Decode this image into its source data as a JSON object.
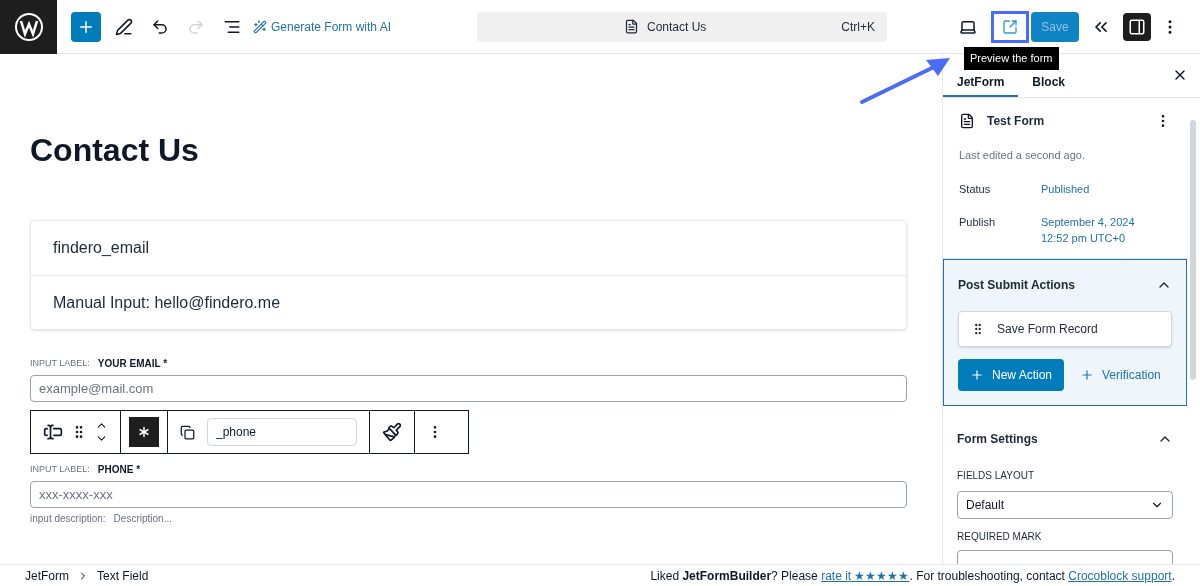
{
  "top_bar": {
    "generate_ai": "Generate Form with AI",
    "document_title": "Contact Us",
    "shortcut": "Ctrl+K",
    "undo_disabled": false,
    "redo_disabled": true,
    "preview_highlighted": true,
    "tooltip": "Preview the form",
    "save": "Save",
    "save_disabled": true,
    "sidebar_open": true
  },
  "canvas": {
    "title": "Contact Us",
    "info_rows": [
      "findero_email",
      "Manual Input: hello@findero.me"
    ],
    "fields": [
      {
        "label_prefix": "INPUT LABEL:",
        "label": "YOUR EMAIL *",
        "placeholder": "example@mail.com"
      },
      {
        "label_prefix": "INPUT LABEL:",
        "label": "PHONE *",
        "placeholder": "xxx-xxxx-xxx",
        "description_prefix": "input description:",
        "description": "Description..."
      }
    ],
    "block_toolbar": {
      "field_name": "_phone",
      "required_on": true
    }
  },
  "breadcrumb": [
    "JetForm",
    "Text Field"
  ],
  "sidebar": {
    "tabs": [
      {
        "label": "JetForm",
        "selected": true
      },
      {
        "label": "Block",
        "selected": false
      }
    ],
    "form": {
      "title": "Test Form",
      "last_edited": "Last edited a second ago.",
      "rows": [
        {
          "label": "Status",
          "value": "Published"
        },
        {
          "label": "Publish",
          "value": "September 4, 2024 12:52 pm UTC+0"
        }
      ]
    },
    "actions_panel": {
      "title": "Post Submit Actions",
      "expanded": true,
      "actions": [
        "Save Form Record"
      ],
      "new_action": "New Action",
      "verification": "Verification"
    },
    "settings_panel": {
      "title": "Form Settings",
      "expanded": true,
      "fields_layout_label": "FIELDS LAYOUT",
      "fields_layout_value": "Default",
      "required_mark_label": "REQUIRED MARK"
    }
  },
  "footer_note": {
    "before": "Liked **JetFormBuilder**? Please",
    "rate_link": "rate it ★★★★★",
    "middle": ". For troubleshooting, contact",
    "support_link": "Crocoblock support",
    "after": "."
  }
}
